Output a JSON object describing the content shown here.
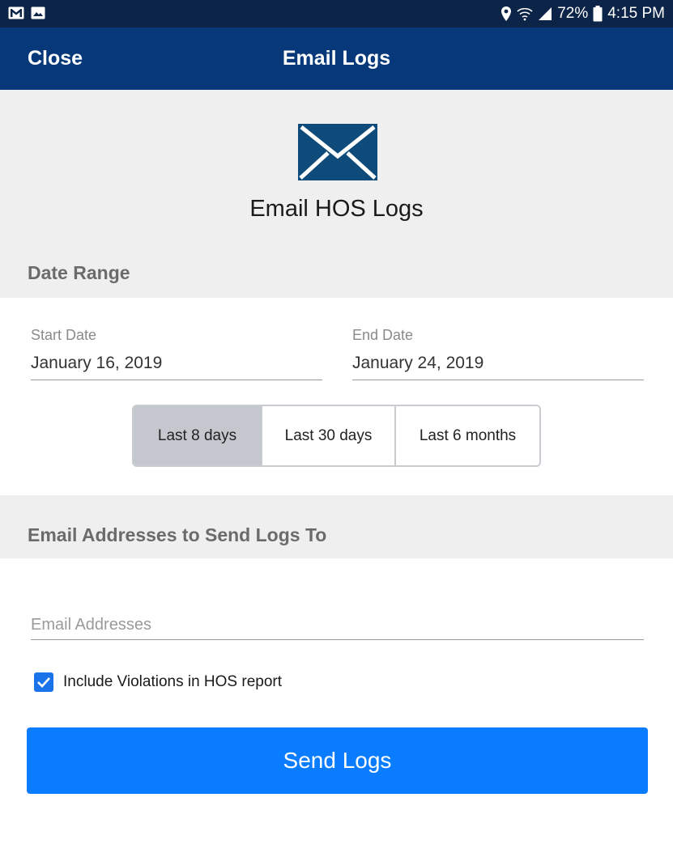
{
  "status_bar": {
    "battery": "72%",
    "time": "4:15 PM"
  },
  "app_bar": {
    "close_label": "Close",
    "title": "Email Logs"
  },
  "hero": {
    "title": "Email HOS Logs",
    "icon": "envelope-icon"
  },
  "date_range": {
    "heading": "Date Range",
    "start_label": "Start Date",
    "start_value": "January 16, 2019",
    "end_label": "End Date",
    "end_value": "January 24, 2019",
    "options": [
      "Last 8 days",
      "Last 30 days",
      "Last 6 months"
    ],
    "selected": "Last 8 days"
  },
  "email": {
    "heading": "Email Addresses to Send Logs To",
    "placeholder": "Email Addresses",
    "include_violations_label": "Include Violations in HOS report",
    "include_violations_checked": true
  },
  "send_button": "Send Logs",
  "colors": {
    "status_bar": "#0b2447",
    "app_bar": "#06387a",
    "accent": "#0a7cff",
    "icon": "#0e4a7a"
  }
}
